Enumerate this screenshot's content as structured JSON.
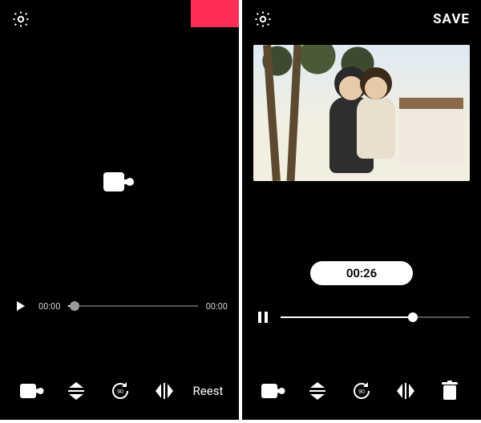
{
  "colors": {
    "accent": "#ff2e56"
  },
  "left": {
    "record_button_color": "#ff2e56",
    "seek": {
      "current": "00:00",
      "duration": "00:00",
      "progress_pct": 5
    },
    "toolbar": {
      "camera_label": "camera",
      "flip_v_label": "flip-vertical",
      "rotate_label": "rotate-90",
      "flip_h_label": "flip-horizontal",
      "reset_label": "Reest"
    }
  },
  "right": {
    "save_label": "SAVE",
    "timer": "00:26",
    "seek": {
      "progress_pct": 70
    },
    "toolbar": {
      "camera_label": "camera",
      "flip_v_label": "flip-vertical",
      "rotate_label": "rotate-90",
      "flip_h_label": "flip-horizontal",
      "delete_label": "delete"
    }
  }
}
